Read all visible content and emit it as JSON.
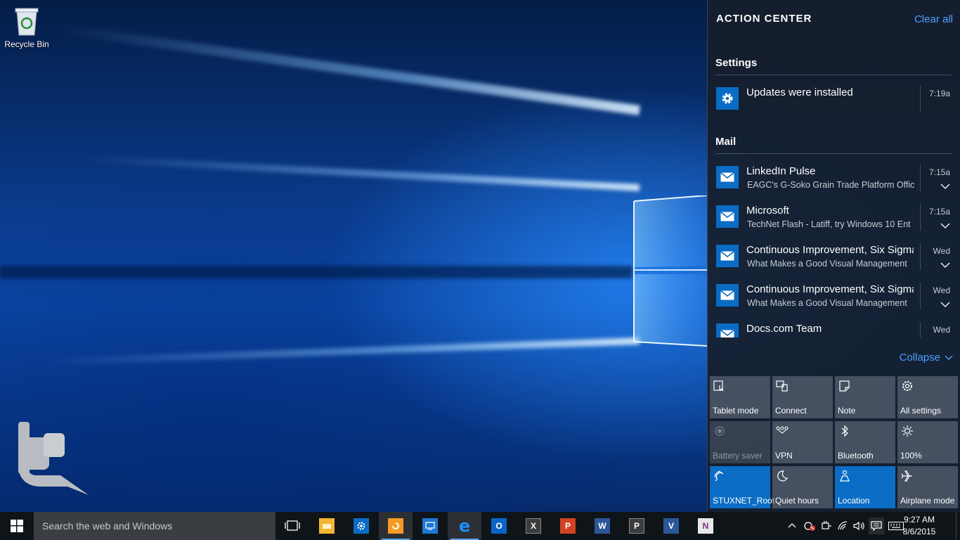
{
  "desktop": {
    "icons": [
      {
        "label": "Recycle Bin"
      }
    ]
  },
  "action_center": {
    "title": "ACTION CENTER",
    "clear_all": "Clear all",
    "groups": [
      {
        "title": "Settings",
        "items": [
          {
            "title": "Updates were installed",
            "body": "",
            "time": "7:19a",
            "icon": "gear-icon"
          }
        ]
      },
      {
        "title": "Mail",
        "items": [
          {
            "title": "LinkedIn Pulse",
            "body": "EAGC's G-Soko Grain Trade Platform Offic",
            "time": "7:15a",
            "icon": "mail-icon"
          },
          {
            "title": "Microsoft",
            "body": "TechNet Flash - Latiff, try Windows 10 Ent",
            "time": "7:15a",
            "icon": "mail-icon"
          },
          {
            "title": "Continuous Improvement, Six Sigma",
            "body": "What Makes a Good Visual Management",
            "time": "Wed",
            "icon": "mail-icon"
          },
          {
            "title": "Continuous Improvement, Six Sigma",
            "body": "What Makes a Good Visual Management",
            "time": "Wed",
            "icon": "mail-icon"
          },
          {
            "title": "Docs.com Team",
            "body": "",
            "time": "Wed",
            "icon": "mail-icon"
          }
        ]
      }
    ],
    "collapse": "Collapse",
    "quick_actions": [
      {
        "label": "Tablet mode",
        "state": "neutral",
        "icon": "tablet-mode-icon"
      },
      {
        "label": "Connect",
        "state": "neutral",
        "icon": "connect-icon"
      },
      {
        "label": "Note",
        "state": "neutral",
        "icon": "note-icon"
      },
      {
        "label": "All settings",
        "state": "neutral",
        "icon": "settings-icon"
      },
      {
        "label": "Battery saver",
        "state": "disabled",
        "icon": "battery-saver-icon"
      },
      {
        "label": "VPN",
        "state": "neutral",
        "icon": "vpn-icon"
      },
      {
        "label": "Bluetooth",
        "state": "neutral",
        "icon": "bluetooth-icon"
      },
      {
        "label": "100%",
        "state": "neutral",
        "icon": "brightness-icon"
      },
      {
        "label": "STUXNET_Root",
        "state": "on",
        "icon": "wifi-icon"
      },
      {
        "label": "Quiet hours",
        "state": "neutral",
        "icon": "moon-icon"
      },
      {
        "label": "Location",
        "state": "on",
        "icon": "location-icon"
      },
      {
        "label": "Airplane mode",
        "state": "neutral",
        "icon": "airplane-icon"
      }
    ]
  },
  "taskbar": {
    "search_placeholder": "Search the web and Windows",
    "apps": [
      {
        "name": "Task View",
        "icon": "task-view-icon",
        "color": "#ffffff",
        "letter": "",
        "active": false
      },
      {
        "name": "File Explorer",
        "icon": "file-explorer-icon",
        "color": "#f2b632",
        "letter": "",
        "active": false
      },
      {
        "name": "Settings",
        "icon": "settings-app-icon",
        "color": "#0a6cc4",
        "letter": "",
        "active": false
      },
      {
        "name": "Snagit",
        "icon": "snagit-icon",
        "color": "#f59b23",
        "letter": "",
        "active": true
      },
      {
        "name": "Remote Desktop",
        "icon": "remote-desktop-icon",
        "color": "#1e78d2",
        "letter": "",
        "active": false
      },
      {
        "name": "Microsoft Edge",
        "icon": "edge-icon",
        "color": "#1e90ff",
        "letter": "e",
        "active": true
      },
      {
        "name": "Outlook",
        "icon": "outlook-icon",
        "color": "#0a64c8",
        "letter": "O",
        "active": false
      },
      {
        "name": "Excel",
        "icon": "excel-icon",
        "color": "#3c3c3c",
        "letter": "X",
        "active": false
      },
      {
        "name": "PowerPoint",
        "icon": "powerpoint-icon",
        "color": "#d04423",
        "letter": "P",
        "active": false
      },
      {
        "name": "Word",
        "icon": "word-icon",
        "color": "#2b5797",
        "letter": "W",
        "active": false
      },
      {
        "name": "Project",
        "icon": "project-icon",
        "color": "#3c3c3c",
        "letter": "P",
        "active": false
      },
      {
        "name": "Visio",
        "icon": "visio-icon",
        "color": "#2b5797",
        "letter": "V",
        "active": false
      },
      {
        "name": "OneNote",
        "icon": "onenote-icon",
        "color": "#e8e8e8",
        "letter": "N",
        "active": false
      }
    ],
    "clock": {
      "time": "9:27 AM",
      "date": "8/6/2015"
    }
  }
}
